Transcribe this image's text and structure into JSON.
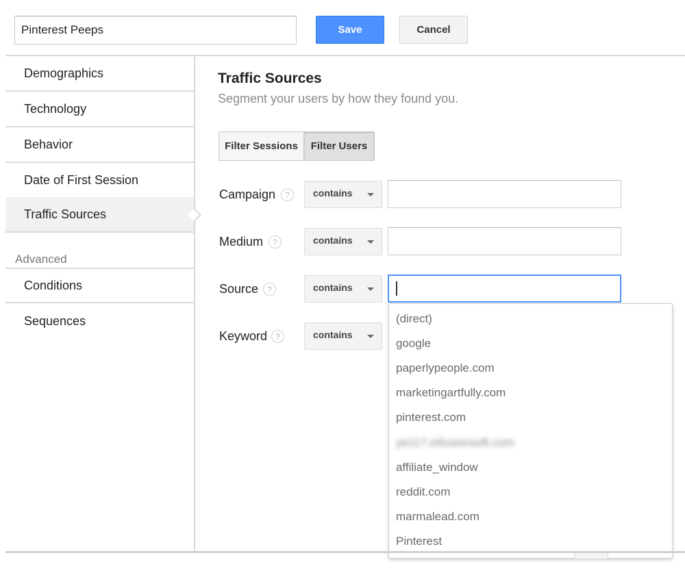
{
  "segment_name": "Pinterest Peeps",
  "toolbar": {
    "save_label": "Save",
    "cancel_label": "Cancel"
  },
  "sidebar": {
    "items": [
      {
        "label": "Demographics"
      },
      {
        "label": "Technology"
      },
      {
        "label": "Behavior"
      },
      {
        "label": "Date of First Session"
      },
      {
        "label": "Traffic Sources",
        "active": true
      }
    ],
    "advanced_heading": "Advanced",
    "advanced_items": [
      {
        "label": "Conditions"
      },
      {
        "label": "Sequences"
      }
    ]
  },
  "main": {
    "title": "Traffic Sources",
    "subtitle": "Segment your users by how they found you.",
    "filter_toggle": {
      "sessions_label": "Filter Sessions",
      "users_label": "Filter Users",
      "selected": "Filter Users"
    },
    "help_glyph": "?",
    "fields": [
      {
        "label": "Campaign",
        "operator": "contains",
        "value": ""
      },
      {
        "label": "Medium",
        "operator": "contains",
        "value": ""
      },
      {
        "label": "Source",
        "operator": "contains",
        "value": "",
        "focused": true
      },
      {
        "label": "Keyword",
        "operator": "contains",
        "value": ""
      }
    ]
  },
  "source_suggestions": [
    "(direct)",
    "google",
    "paperlypeople.com",
    "marketingartfully.com",
    "pinterest.com",
    "ye117.infusionsoft.com",
    "affiliate_window",
    "reddit.com",
    "marmalead.com",
    "Pinterest"
  ],
  "colors": {
    "primary_button": "#4d90fe",
    "focus_border": "#4d90fe",
    "active_sidebar": "#f1f1f1"
  }
}
